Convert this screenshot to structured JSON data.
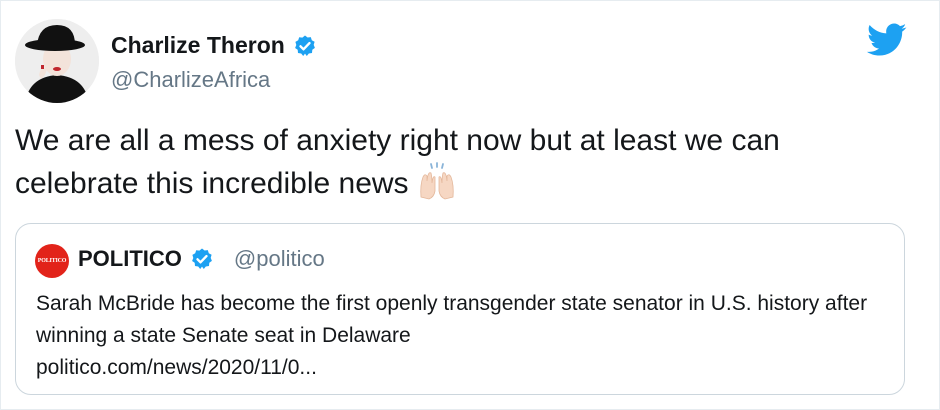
{
  "tweet": {
    "author": {
      "name": "Charlize Theron",
      "handle": "@CharlizeAfrica",
      "verified": true
    },
    "text": "We are all a mess of anxiety right now but at least we can celebrate this incredible news",
    "emoji_icon": "raising-hands-icon"
  },
  "quoted": {
    "logo_text": "POLITICO",
    "author": {
      "name": "POLITICO",
      "handle": "@politico",
      "verified": true
    },
    "text": "Sarah McBride has become the first openly transgender state senator in U.S. history after winning a state Senate seat in Delaware",
    "link": "politico.com/news/2020/11/0..."
  },
  "colors": {
    "verified_blue": "#1da1f2",
    "twitter_blue": "#1da1f2",
    "politico_red": "#e2231a",
    "muted": "#657786"
  }
}
